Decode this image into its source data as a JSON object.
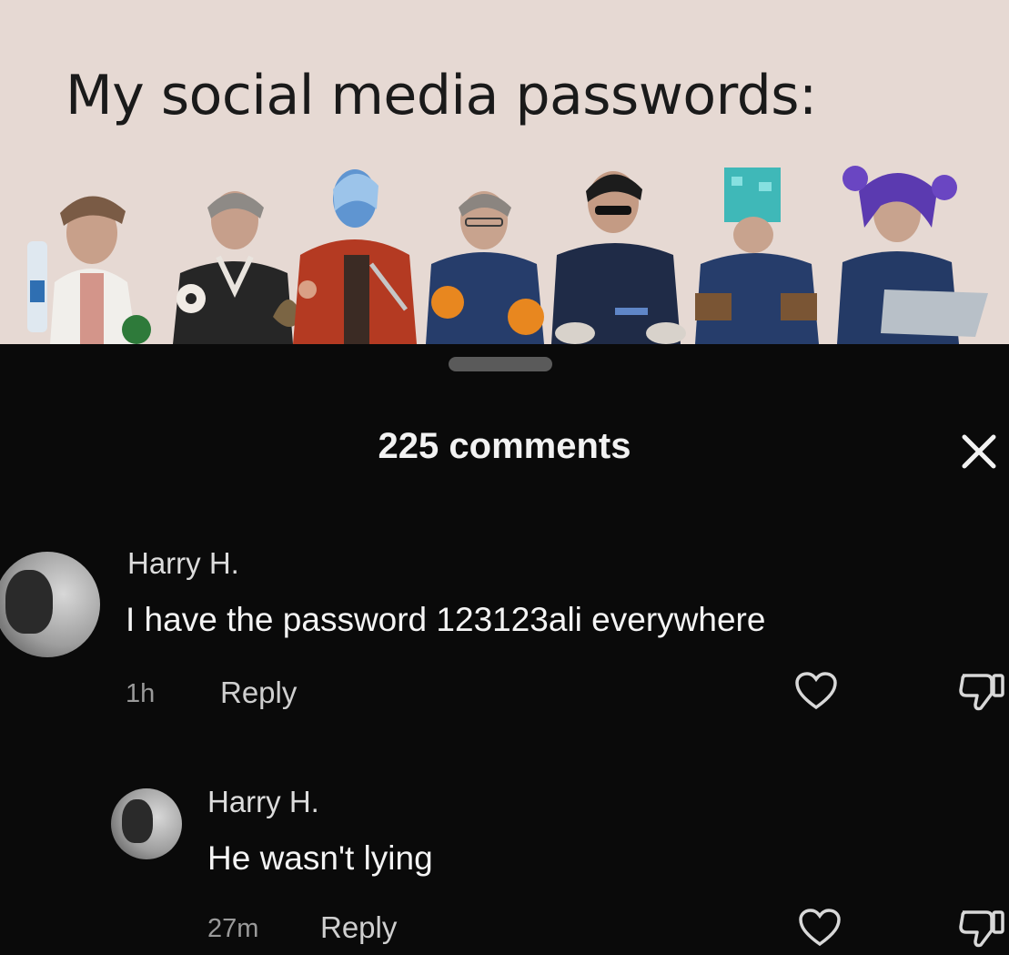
{
  "meme": {
    "title": "My social media passwords:"
  },
  "sheet": {
    "title": "225 comments",
    "close_icon": "close-icon"
  },
  "comments": [
    {
      "username": "Harry H.",
      "text": "I have the password 123123ali everywhere",
      "time": "1h",
      "reply_label": "Reply"
    },
    {
      "username": "Harry H.",
      "text": "He wasn't lying",
      "time": "27m",
      "reply_label": "Reply"
    }
  ],
  "colors": {
    "background": "#0a0a0a",
    "meme_background": "#e6d9d3"
  }
}
